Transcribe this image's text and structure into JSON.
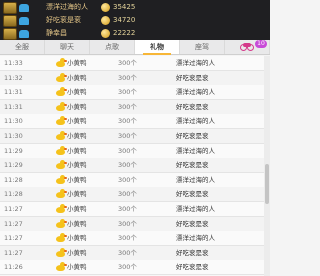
{
  "ranking": [
    {
      "name": "漂洋过海的人",
      "coins": "35425"
    },
    {
      "name": "好吃衮是衮",
      "coins": "34720"
    },
    {
      "name": "静幸昌",
      "coins": "22222"
    }
  ],
  "tabs": [
    {
      "label": "全服"
    },
    {
      "label": "聊天"
    },
    {
      "label": "点歌"
    },
    {
      "label": "礼物"
    },
    {
      "label": "座驾"
    },
    {
      "label": "",
      "badge": "10"
    }
  ],
  "active_tab": "礼物",
  "gift_log": [
    {
      "time": "11:33",
      "gift": "小黄鸭",
      "qty": "300个",
      "sender": "漂洋过海的人"
    },
    {
      "time": "11:32",
      "gift": "小黄鸭",
      "qty": "300个",
      "sender": "好吃衮是衮"
    },
    {
      "time": "11:31",
      "gift": "小黄鸭",
      "qty": "300个",
      "sender": "漂洋过海的人"
    },
    {
      "time": "11:31",
      "gift": "小黄鸭",
      "qty": "300个",
      "sender": "好吃衮是衮"
    },
    {
      "time": "11:30",
      "gift": "小黄鸭",
      "qty": "300个",
      "sender": "漂洋过海的人"
    },
    {
      "time": "11:30",
      "gift": "小黄鸭",
      "qty": "300个",
      "sender": "好吃衮是衮"
    },
    {
      "time": "11:29",
      "gift": "小黄鸭",
      "qty": "300个",
      "sender": "漂洋过海的人"
    },
    {
      "time": "11:29",
      "gift": "小黄鸭",
      "qty": "300个",
      "sender": "好吃衮是衮"
    },
    {
      "time": "11:28",
      "gift": "小黄鸭",
      "qty": "300个",
      "sender": "漂洋过海的人"
    },
    {
      "time": "11:28",
      "gift": "小黄鸭",
      "qty": "300个",
      "sender": "好吃衮是衮"
    },
    {
      "time": "11:27",
      "gift": "小黄鸭",
      "qty": "300个",
      "sender": "漂洋过海的人"
    },
    {
      "time": "11:27",
      "gift": "小黄鸭",
      "qty": "300个",
      "sender": "好吃衮是衮"
    },
    {
      "time": "11:27",
      "gift": "小黄鸭",
      "qty": "300个",
      "sender": "漂洋过海的人"
    },
    {
      "time": "11:27",
      "gift": "小黄鸭",
      "qty": "300个",
      "sender": "好吃衮是衮"
    },
    {
      "time": "11:26",
      "gift": "小黄鸭",
      "qty": "300个",
      "sender": "好吃衮是衮"
    }
  ],
  "icons": {
    "rank_badge": "rank-badge-icon",
    "vehicle": "car-icon",
    "coin": "coin-icon",
    "gift": "duck-icon",
    "last_tab": "motorbike-icon"
  },
  "colors": {
    "accent": "#f7b637",
    "panel_bg": "#1f1f22",
    "badge_bg": "#c84bd8"
  }
}
